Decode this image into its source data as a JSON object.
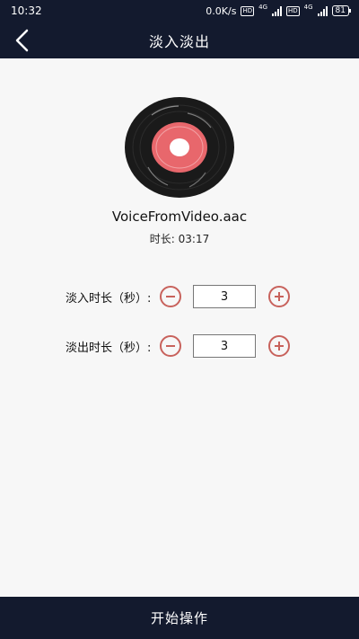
{
  "status_bar": {
    "time": "10:32",
    "net_speed": "0.0K/s",
    "hd_label": "HD",
    "network_type": "4G",
    "battery": "81"
  },
  "header": {
    "title": "淡入淡出",
    "back_icon": "chevron-left-icon"
  },
  "media": {
    "file_name": "VoiceFromVideo.aac",
    "duration_label": "时长",
    "duration_sep": ": ",
    "duration_value": "03:17"
  },
  "settings": {
    "fade_in": {
      "label": "淡入时长（秒）:",
      "value": "3"
    },
    "fade_out": {
      "label": "淡出时长（秒）:",
      "value": "3"
    }
  },
  "footer": {
    "start_label": "开始操作"
  },
  "colors": {
    "dark_bar": "#131a2e",
    "accent": "#c8625c",
    "record_center": "#e8676c",
    "background": "#f7f7f7"
  }
}
